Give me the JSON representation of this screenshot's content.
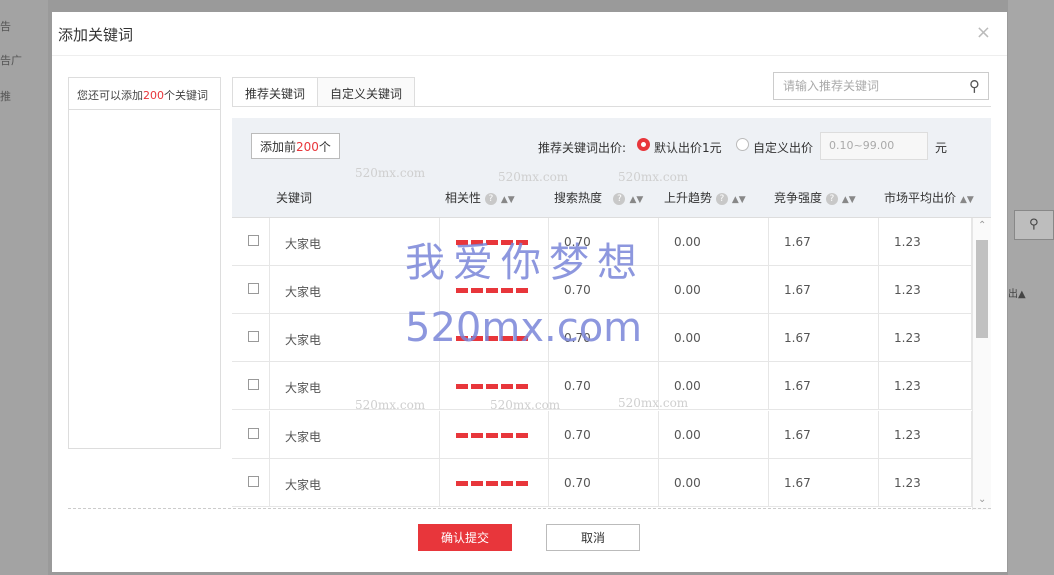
{
  "background": {
    "side_items": [
      "告",
      "告广",
      "推"
    ],
    "right_partial": [
      "出▲"
    ]
  },
  "modal": {
    "title": "添加关键词",
    "close": "×"
  },
  "left_panel": {
    "prefix": "您还可以添加",
    "count": "200",
    "suffix": "个关键词"
  },
  "tabs": [
    {
      "label": "推荐关键词",
      "active": true
    },
    {
      "label": "自定义关键词",
      "active": false
    }
  ],
  "search": {
    "placeholder": "请输入推荐关键词"
  },
  "toolbar": {
    "add_prefix": "添加前",
    "add_count": "200",
    "add_suffix": "个",
    "bid_label": "推荐关键词出价:",
    "default_bid": "默认出价1元",
    "custom_bid": "自定义出价",
    "bid_input_placeholder": "0.10~99.00",
    "unit": "元"
  },
  "table": {
    "headers": {
      "keyword": "关键词",
      "relevance": "相关性",
      "search_heat": "搜索热度",
      "trend": "上升趋势",
      "competition": "竞争强度",
      "avg_bid": "市场平均出价"
    },
    "rows": [
      {
        "keyword": "大家电",
        "relevance_level": 5,
        "heat": "0.70",
        "trend": "0.00",
        "competition": "1.67",
        "avg_bid": "1.23"
      },
      {
        "keyword": "大家电",
        "relevance_level": 5,
        "heat": "0.70",
        "trend": "0.00",
        "competition": "1.67",
        "avg_bid": "1.23"
      },
      {
        "keyword": "大家电",
        "relevance_level": 5,
        "heat": "0.70",
        "trend": "0.00",
        "competition": "1.67",
        "avg_bid": "1.23"
      },
      {
        "keyword": "大家电",
        "relevance_level": 5,
        "heat": "0.70",
        "trend": "0.00",
        "competition": "1.67",
        "avg_bid": "1.23"
      },
      {
        "keyword": "大家电",
        "relevance_level": 5,
        "heat": "0.70",
        "trend": "0.00",
        "competition": "1.67",
        "avg_bid": "1.23"
      },
      {
        "keyword": "大家电",
        "relevance_level": 5,
        "heat": "0.70",
        "trend": "0.00",
        "competition": "1.67",
        "avg_bid": "1.23"
      }
    ]
  },
  "footer": {
    "confirm": "确认提交",
    "cancel": "取消"
  },
  "watermark": {
    "text": "我爱你梦想",
    "url": "520mx.com",
    "small": "520mx.com"
  },
  "colors": {
    "accent": "#e8363b",
    "watermark": "#7a86d9"
  }
}
